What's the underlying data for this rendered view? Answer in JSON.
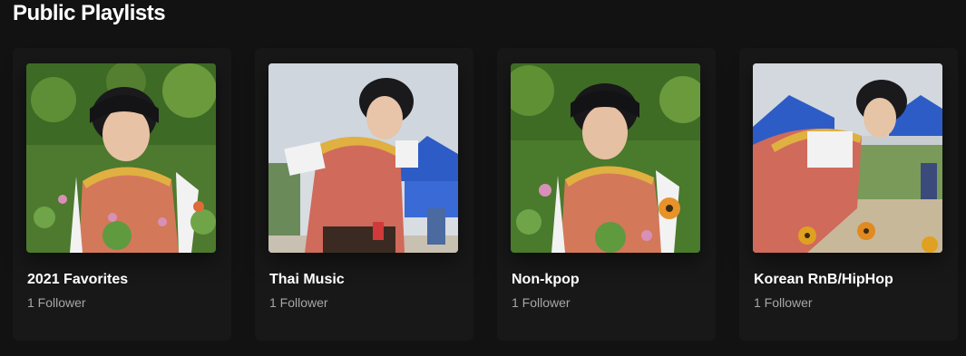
{
  "section": {
    "title": "Public Playlists"
  },
  "colors": {
    "background": "#121212",
    "card": "#181818",
    "subtext": "#a7a7a7"
  },
  "playlists": [
    {
      "title": "2021 Favorites",
      "followers": "1 Follower",
      "cover": "photo-garden-greenery"
    },
    {
      "title": "Thai Music",
      "followers": "1 Follower",
      "cover": "photo-sky-tent"
    },
    {
      "title": "Non-kpop",
      "followers": "1 Follower",
      "cover": "photo-garden-flowers"
    },
    {
      "title": "Korean RnB/HipHop",
      "followers": "1 Follower",
      "cover": "photo-tent-flowers"
    }
  ]
}
